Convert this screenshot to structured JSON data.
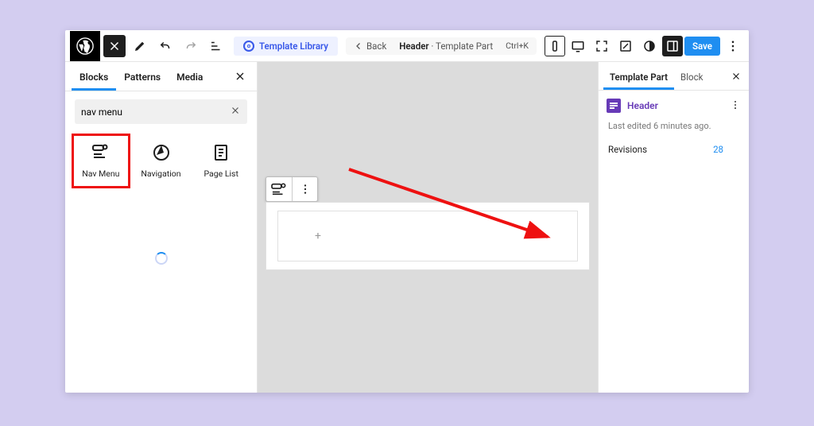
{
  "topbar": {
    "template_library_label": "Template Library",
    "back_label": "Back",
    "doc_title_bold": "Header",
    "doc_title_rest": " · Template Part",
    "shortcut": "Ctrl+K",
    "save_label": "Save"
  },
  "left_panel": {
    "tabs": [
      "Blocks",
      "Patterns",
      "Media"
    ],
    "active_tab": 0,
    "search_value": "nav menu",
    "blocks": [
      {
        "label": "Nav Menu",
        "highlight": true
      },
      {
        "label": "Navigation",
        "highlight": false
      },
      {
        "label": "Page List",
        "highlight": false
      }
    ]
  },
  "right_panel": {
    "tabs": [
      "Template Part",
      "Block"
    ],
    "active_tab": 0,
    "header_label": "Header",
    "meta": "Last edited 6 minutes ago.",
    "revisions_label": "Revisions",
    "revisions_count": "28"
  }
}
